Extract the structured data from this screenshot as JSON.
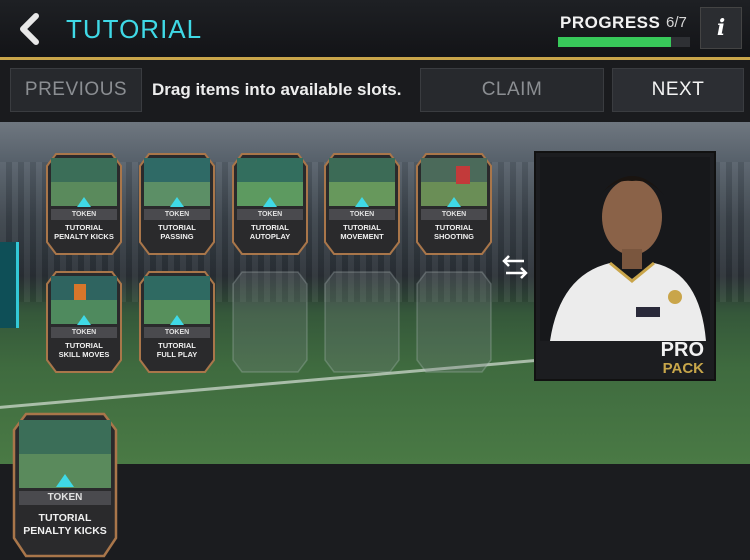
{
  "header": {
    "title": "TUTORIAL",
    "progress_label": "PROGRESS",
    "progress_count": "6/7",
    "progress_fraction": 0.857,
    "info_label": "i"
  },
  "toolbar": {
    "previous_label": "PREVIOUS",
    "instruction": "Drag items into available slots.",
    "claim_label": "CLAIM",
    "next_label": "NEXT"
  },
  "cards": [
    {
      "token": "TOKEN",
      "name": "TUTORIAL\nPENALTY KICKS"
    },
    {
      "token": "TOKEN",
      "name": "TUTORIAL\nPASSING"
    },
    {
      "token": "TOKEN",
      "name": "TUTORIAL\nAUTOPLAY"
    },
    {
      "token": "TOKEN",
      "name": "TUTORIAL\nMOVEMENT"
    },
    {
      "token": "TOKEN",
      "name": "TUTORIAL\nSHOOTING"
    },
    {
      "token": "TOKEN",
      "name": "TUTORIAL\nSKILL MOVES"
    },
    {
      "token": "TOKEN",
      "name": "TUTORIAL\nFULL PLAY"
    }
  ],
  "pack": {
    "line1": "PRO",
    "line2": "PACK"
  },
  "tray_card": {
    "token": "TOKEN",
    "name": "TUTORIAL\nPENALTY KICKS"
  },
  "colors": {
    "accent": "#3fd9e6",
    "progress": "#38c95a",
    "gold": "#c9a54a"
  }
}
